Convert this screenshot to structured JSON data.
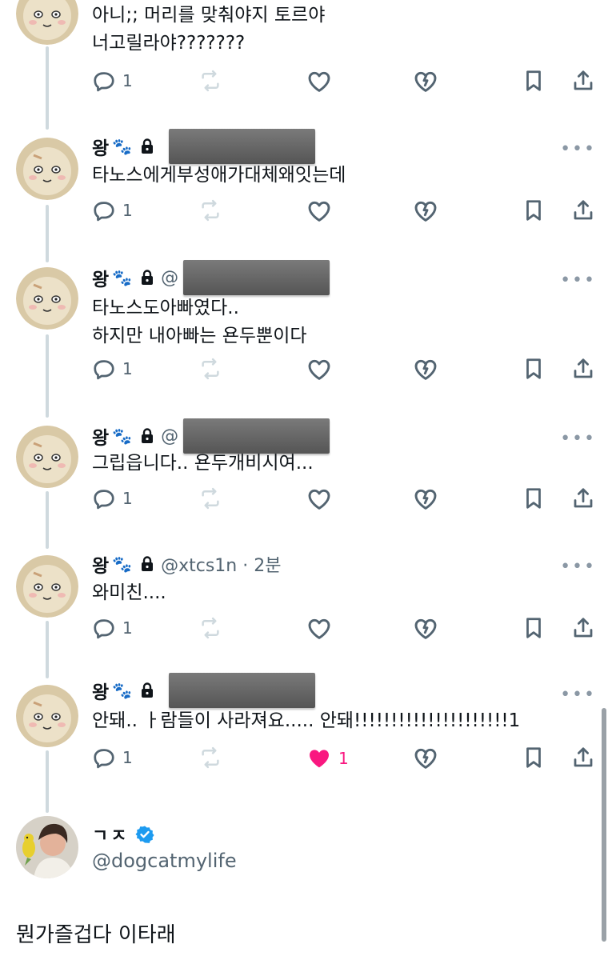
{
  "tweets": [
    {
      "name": "",
      "handle": "",
      "text": "아니;; 머리를 맞춰야지 토르야\n너고릴라야???????",
      "reply_count": "1",
      "like_count": "",
      "liked": false
    },
    {
      "name": "왕",
      "handle": "",
      "text": "타노스에게부성애가대체왜잇는데",
      "reply_count": "1",
      "like_count": "",
      "liked": false
    },
    {
      "name": "왕",
      "handle": "@",
      "text": "타노스도아빠였다..\n하지만 내아빠는 욘두뿐이다",
      "reply_count": "1",
      "like_count": "",
      "liked": false
    },
    {
      "name": "왕",
      "handle": "@",
      "text": "그립읍니다.. 욘두개비시여...",
      "reply_count": "1",
      "like_count": "",
      "liked": false
    },
    {
      "name": "왕",
      "handle": "@xtcs1n · 2분",
      "text": "와미친....",
      "reply_count": "1",
      "like_count": "",
      "liked": false
    },
    {
      "name": "왕",
      "handle": "",
      "text": "안돼.. ㅏ람들이 사라져요..... 안돼!!!!!!!!!!!!!!!!!!!!!1",
      "reply_count": "1",
      "like_count": "1",
      "liked": true
    }
  ],
  "icons": {
    "reply": "reply-icon",
    "retweet": "retweet-icon",
    "like": "heart-icon",
    "dislike": "broken-heart-icon",
    "bookmark": "bookmark-icon",
    "share": "share-icon",
    "more": "more-icon",
    "lock": "lock-icon",
    "verified": "verified-badge-icon",
    "paws": "paw-icon"
  },
  "profile": {
    "name": "ㄱㅈ",
    "handle": "@dogcatmylife",
    "bio": "뭔가즐겁다 이타래"
  },
  "colors": {
    "text": "#0f1419",
    "muted": "#536471",
    "like": "#f91880",
    "verified": "#1d9bf0",
    "thread_line": "#cfd9de"
  }
}
